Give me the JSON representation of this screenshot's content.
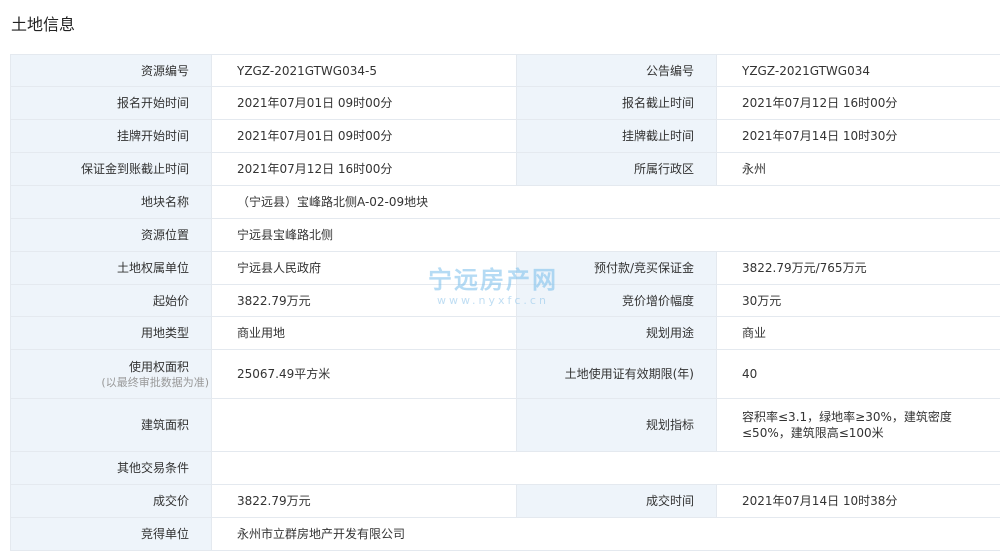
{
  "section_title": "土地信息",
  "rows": [
    {
      "l1": "资源编号",
      "v1": "YZGZ-2021GTWG034-5",
      "l2": "公告编号",
      "v2": "YZGZ-2021GTWG034"
    },
    {
      "l1": "报名开始时间",
      "v1": "2021年07月01日 09时00分",
      "l2": "报名截止时间",
      "v2": "2021年07月12日 16时00分"
    },
    {
      "l1": "挂牌开始时间",
      "v1": "2021年07月01日 09时00分",
      "l2": "挂牌截止时间",
      "v2": "2021年07月14日 10时30分"
    },
    {
      "l1": "保证金到账截止时间",
      "v1": "2021年07月12日 16时00分",
      "l2": "所属行政区",
      "v2": "永州"
    },
    {
      "l1": "地块名称",
      "v1": "（宁远县）宝峰路北侧A-02-09地块"
    },
    {
      "l1": "资源位置",
      "v1": "宁远县宝峰路北侧"
    },
    {
      "l1": "土地权属单位",
      "v1": "宁远县人民政府",
      "l2": "预付款/竞买保证金",
      "v2": "3822.79万元/765万元"
    },
    {
      "l1": "起始价",
      "v1": "3822.79万元",
      "l2": "竞价增价幅度",
      "v2": "30万元"
    },
    {
      "l1": "用地类型",
      "v1": "商业用地",
      "l2": "规划用途",
      "v2": "商业"
    },
    {
      "l1": "使用权面积",
      "l1_note": "(以最终审批数据为准)",
      "v1": "25067.49平方米",
      "l2": "土地使用证有效期限(年)",
      "v2": "40"
    },
    {
      "l1": "建筑面积",
      "v1": "",
      "l2": "规划指标",
      "v2": "容积率≤3.1，绿地率≥30%，建筑密度≤50%，建筑限高≤100米"
    },
    {
      "l1": "其他交易条件",
      "v1": ""
    },
    {
      "l1": "成交价",
      "v1": "3822.79万元",
      "l2": "成交时间",
      "v2": "2021年07月14日 10时38分"
    },
    {
      "l1": "竞得单位",
      "v1": "永州市立群房地产开发有限公司"
    }
  ],
  "watermark": {
    "title": "宁远房产网",
    "url": "www.nyxfc.cn"
  }
}
